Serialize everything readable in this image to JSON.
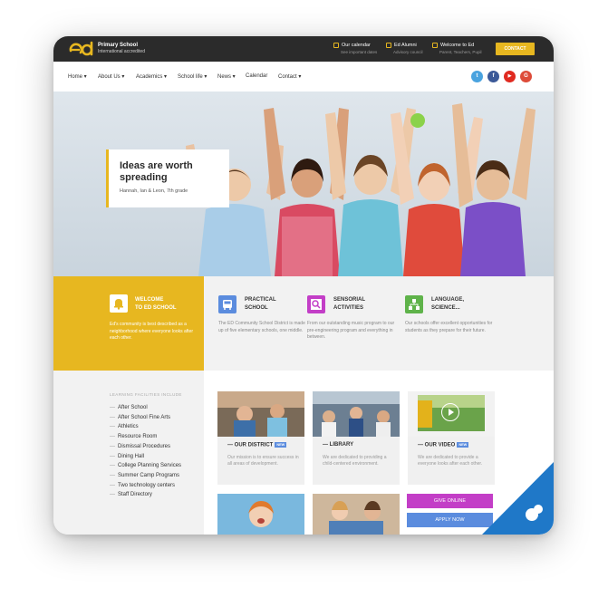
{
  "header": {
    "brand_title": "Primary School",
    "brand_sub": "International accredited",
    "info": [
      {
        "title": "Our calendar",
        "sub": "See important dates"
      },
      {
        "title": "Ed Alumni",
        "sub": "Advisory council"
      },
      {
        "title": "Welcome to Ed",
        "sub": "Parent, Teachers, Pupil"
      }
    ],
    "contact_label": "CONTACT"
  },
  "nav": {
    "items": [
      "Home ▾",
      "About Us ▾",
      "Academics ▾",
      "School life ▾",
      "News ▾",
      "Calendar",
      "Contact ▾"
    ],
    "social": [
      {
        "icon": "twitter-icon",
        "glyph": "t",
        "color": "#4aa3df"
      },
      {
        "icon": "facebook-icon",
        "glyph": "f",
        "color": "#3b5998"
      },
      {
        "icon": "youtube-icon",
        "glyph": "▶",
        "color": "#e02a20"
      },
      {
        "icon": "google-plus-icon",
        "glyph": "G",
        "color": "#dd4b39"
      }
    ]
  },
  "hero": {
    "title": "Ideas are worth spreading",
    "subtitle": "Hannah, Ian & Leon, 7th grade"
  },
  "welcome": {
    "title_line1": "WELCOME",
    "title_line2": "TO ED SCHOOL",
    "text": "Ed's community is best described as a neighborhood where everyone looks after each other."
  },
  "features": [
    {
      "title_line1": "PRACTICAL",
      "title_line2": "SCHOOL",
      "text": "The ED Community School District is made up of five elementary schools, one middle.",
      "icon": "bus-icon",
      "color": "#5b8cde"
    },
    {
      "title_line1": "SENSORIAL",
      "title_line2": "ACTIVITIES",
      "text": "From our outstanding music program to our pre-engineering program and everything in between.",
      "icon": "magnifier-icon",
      "color": "#c33ec7"
    },
    {
      "title_line1": "LANGUAGE,",
      "title_line2": "SCIENCE...",
      "text": "Our schools offer excellent opportunities for students as they prepare for their future.",
      "icon": "network-icon",
      "color": "#5fb34a"
    }
  ],
  "facilities": {
    "header": "LEARNING FACILITIES INCLUDE",
    "items": [
      "After School",
      "After School Fine Arts",
      "Athletics",
      "Resource Room",
      "Dismissal Procedures",
      "Dining Hall",
      "College Planning Services",
      "Summer Camp Programs",
      "Two technology centers",
      "Staff Directory"
    ]
  },
  "cards": [
    {
      "title": "— OUR DISTRICT",
      "badge": "NEW",
      "text": "Our mission is to ensure success in all areas of development."
    },
    {
      "title": "— LIBRARY",
      "badge": "",
      "text": "We are dedicated to providing a child-centered environment."
    },
    {
      "title": "— OUR VIDEO",
      "badge": "NEW",
      "text": "We are dedicated to provide a everyone looks after each other."
    }
  ],
  "buttons": {
    "give_online": "GIVE ONLINE",
    "apply_now": "APPLY NOW"
  }
}
